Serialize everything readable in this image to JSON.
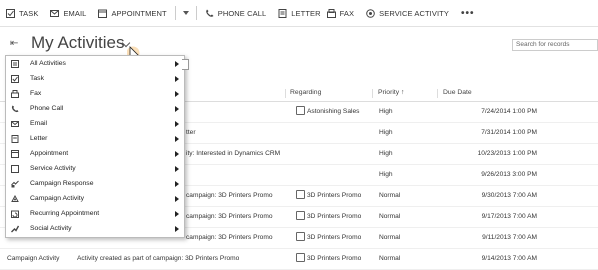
{
  "toolbar": {
    "items": [
      {
        "label": "TASK",
        "icon": "task-icon"
      },
      {
        "label": "EMAIL",
        "icon": "email-icon"
      },
      {
        "label": "APPOINTMENT",
        "icon": "appointment-icon"
      },
      {
        "label": "PHONE CALL",
        "icon": "phone-icon"
      },
      {
        "label": "LETTER",
        "icon": "letter-icon"
      },
      {
        "label": "FAX",
        "icon": "fax-icon"
      },
      {
        "label": "SERVICE ACTIVITY",
        "icon": "service-activity-icon"
      }
    ],
    "more": "•••"
  },
  "view": {
    "title": "My Activities",
    "search_placeholder": "Search for records"
  },
  "grid": {
    "headers": {
      "regarding": "Regarding",
      "priority": "Priority ↑",
      "due": "Due Date"
    },
    "rows": [
      {
        "type": "",
        "subject": "",
        "regarding": "Astonishing Sales",
        "regarding_icon": true,
        "priority": "High",
        "due": "7/24/2014 1:00 PM"
      },
      {
        "type": "",
        "subject": "tter",
        "regarding": "",
        "regarding_icon": false,
        "priority": "High",
        "due": "7/31/2014 1:00 PM"
      },
      {
        "type": "",
        "subject": "ity: Interested in Dynamics CRM",
        "regarding": "",
        "regarding_icon": false,
        "priority": "High",
        "due": "10/23/2013 1:00 PM"
      },
      {
        "type": "",
        "subject": "",
        "regarding": "",
        "regarding_icon": false,
        "priority": "High",
        "due": "9/26/2013 3:00 PM"
      },
      {
        "type": "",
        "subject": "campaign: 3D Printers Promo",
        "regarding": "3D Printers Promo",
        "regarding_icon": true,
        "priority": "Normal",
        "due": "9/30/2013 7:00 AM"
      },
      {
        "type": "",
        "subject": "campaign: 3D Printers Promo",
        "regarding": "3D Printers Promo",
        "regarding_icon": true,
        "priority": "Normal",
        "due": "9/17/2013 7:00 AM"
      },
      {
        "type": "",
        "subject": "campaign: 3D Printers Promo",
        "regarding": "3D Printers Promo",
        "regarding_icon": true,
        "priority": "Normal",
        "due": "9/11/2013 7:00 AM"
      },
      {
        "type": "Campaign Activity",
        "subject": "Activity created as part of campaign: 3D Printers Promo",
        "regarding": "3D Printers Promo",
        "regarding_icon": true,
        "priority": "Normal",
        "due": "9/14/2013 7:00 AM"
      }
    ]
  },
  "menu": {
    "items": [
      {
        "label": "All Activities",
        "icon": "all-activities-icon"
      },
      {
        "label": "Task",
        "icon": "task-icon"
      },
      {
        "label": "Fax",
        "icon": "fax-icon"
      },
      {
        "label": "Phone Call",
        "icon": "phone-icon"
      },
      {
        "label": "Email",
        "icon": "email-icon"
      },
      {
        "label": "Letter",
        "icon": "letter-icon"
      },
      {
        "label": "Appointment",
        "icon": "appointment-icon"
      },
      {
        "label": "Service Activity",
        "icon": "service-activity-icon"
      },
      {
        "label": "Campaign Response",
        "icon": "campaign-response-icon"
      },
      {
        "label": "Campaign Activity",
        "icon": "campaign-activity-icon"
      },
      {
        "label": "Recurring Appointment",
        "icon": "recurring-appointment-icon"
      },
      {
        "label": "Social Activity",
        "icon": "social-activity-icon"
      }
    ]
  }
}
